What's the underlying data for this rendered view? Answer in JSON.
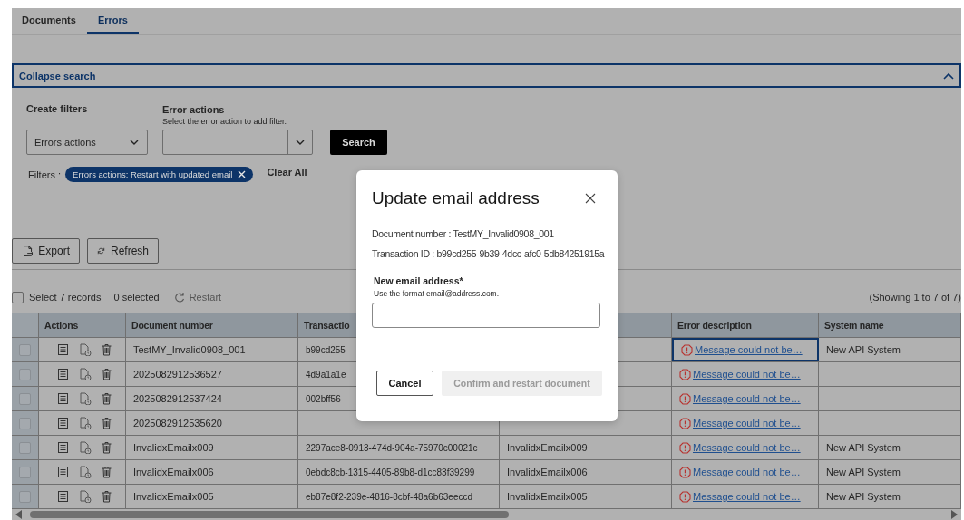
{
  "tabs": [
    {
      "label": "Documents",
      "selected": false
    },
    {
      "label": "Errors",
      "selected": true
    }
  ],
  "search_panel": {
    "title": "Collapse search",
    "expanded": true,
    "create_filters": {
      "label": "Create filters",
      "value": "Errors actions"
    },
    "error_actions": {
      "label": "Error actions",
      "hint": "Select the error action to add filter."
    },
    "search_button": "Search",
    "filters_label": "Filters :",
    "filter_chips": [
      {
        "label": "Errors actions: Restart with updated email"
      }
    ],
    "clear_all": "Clear All"
  },
  "buttons": [
    {
      "label": "Export",
      "kind": "export"
    },
    {
      "label": "Refresh",
      "kind": "refresh"
    }
  ],
  "toolbar": {
    "select_all": {
      "label": "Select 7 records",
      "checked": false
    },
    "selected_count": "0 selected",
    "restart": {
      "label": "Restart",
      "disabled": true
    },
    "showing": "(Showing 1 to 7 of 7)"
  },
  "table": {
    "columns": [
      {
        "label": "Actions",
        "kind": "actions"
      },
      {
        "label": "Document number",
        "kind": "text"
      },
      {
        "label": "Transactio",
        "kind": "id"
      },
      {
        "kind": "text"
      },
      {
        "label": "Error description",
        "kind": "error"
      },
      {
        "label": "System name",
        "kind": "text"
      }
    ],
    "rows": [
      {
        "checked": false,
        "focused": true,
        "cells": [
          "",
          "TestMY_Invalid0908_001",
          "b99cd255",
          "",
          "Message could not be…",
          "New API System"
        ]
      },
      {
        "checked": false,
        "focused": false,
        "cells": [
          "",
          "2025082912536527",
          "4d9a1a1e",
          "",
          "Message could not be…",
          ""
        ]
      },
      {
        "checked": false,
        "focused": false,
        "cells": [
          "",
          "2025082912537424",
          "002bff56-",
          "",
          "Message could not be…",
          ""
        ]
      },
      {
        "checked": false,
        "focused": false,
        "cells": [
          "",
          "2025082912535620",
          "",
          "",
          "Message could not be…",
          ""
        ]
      },
      {
        "checked": false,
        "focused": false,
        "cells": [
          "",
          "InvalidxEmailx009",
          "2297ace8-0913-474d-904a-75970c00021c",
          "InvalidxEmailx009",
          "Message could not be…",
          "New API System"
        ]
      },
      {
        "checked": false,
        "focused": false,
        "cells": [
          "",
          "InvalidxEmailx006",
          "0ebdc8cb-1315-4405-89b8-d1cc83f39299",
          "InvalidxEmailx006",
          "Message could not be…",
          "New API System"
        ]
      },
      {
        "checked": false,
        "focused": false,
        "cells": [
          "",
          "InvalidxEmailx005",
          "eb87e8f2-239e-4816-8cbf-48a6b63eeccd",
          "InvalidxEmailx005",
          "Message could not be…",
          "New API System"
        ]
      }
    ]
  },
  "dialog": {
    "title": "Update email address",
    "document_number": "Document number : TestMY_Invalid0908_001",
    "transaction_id": "Transaction ID : b99cd255-9b39-4dcc-afc0-5db84251915a",
    "field": {
      "label": "New email address*",
      "hint": "Use the format email@address.com."
    },
    "cancel": "Cancel",
    "confirm": {
      "label": "Confirm and restart document",
      "disabled": true
    }
  }
}
